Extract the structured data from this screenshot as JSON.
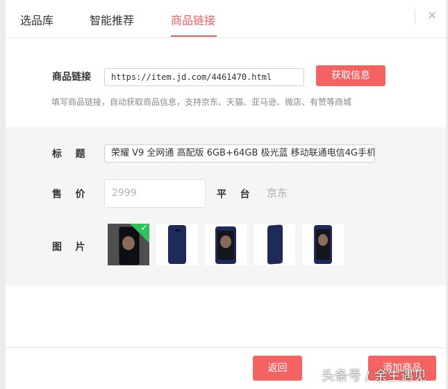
{
  "tabs": [
    "选品库",
    "智能推荐",
    "商品链接"
  ],
  "active_tab": "商品链接",
  "close_icon": "close-icon",
  "link": {
    "label": "商品链接",
    "value": "https://item.jd.com/4461470.html",
    "fetch_label": "获取信息",
    "hint": "填写商品链接，自动获取商品信息，支持京东、天猫、亚马逊、微店、有赞等商城"
  },
  "product": {
    "title_label": "标    题",
    "title_value": "荣耀 V9 全网通 高配版 6GB+64GB 极光蓝 移动联通电信4G手机",
    "price_label": "售    价",
    "price_placeholder": "2999",
    "platform_label": "平    台",
    "platform_value": "京东",
    "images_label": "图    片",
    "images": [
      {
        "type": "front-screen",
        "selected": true
      },
      {
        "type": "back",
        "selected": false
      },
      {
        "type": "front-screen",
        "selected": false
      },
      {
        "type": "side-back",
        "selected": false
      },
      {
        "type": "front-screen",
        "selected": false
      }
    ]
  },
  "footer": {
    "back_label": "返回",
    "add_label": "添加商品"
  },
  "watermark": "头条号 / 余生遇见",
  "colors": {
    "accent": "#f46262",
    "active_tab": "#ee5c5c",
    "selected_check": "#2ec25b",
    "phone_blue": "#1d2a5a"
  }
}
